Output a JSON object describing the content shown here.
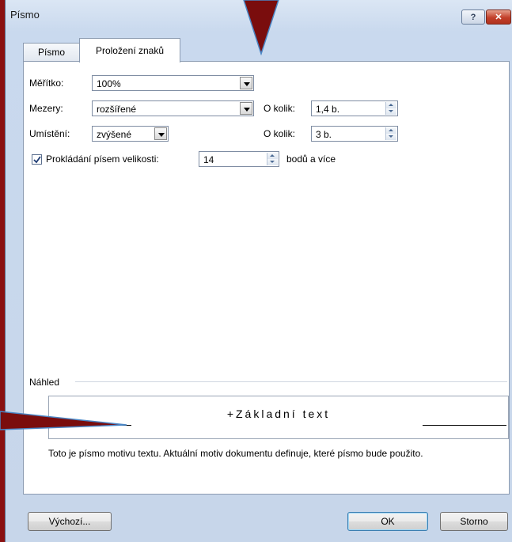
{
  "window": {
    "title": "Písmo"
  },
  "tabs": [
    {
      "label": "Písmo",
      "active": false
    },
    {
      "label": "Proložení znaků",
      "active": true
    }
  ],
  "fields": {
    "scale": {
      "label": "Měřítko:",
      "value": "100%"
    },
    "spacing": {
      "label": "Mezery:",
      "value": "rozšířené",
      "by_label": "O kolik:",
      "by_value": "1,4 b."
    },
    "position": {
      "label": "Umístění:",
      "value": "zvýšené",
      "by_label": "O kolik:",
      "by_value": "3 b."
    },
    "kerning": {
      "checked": true,
      "label": "Prokládání písem velikosti:",
      "value": "14",
      "suffix": "bodů a více"
    }
  },
  "preview": {
    "heading": "Náhled",
    "sample": "+Základní text",
    "description": "Toto je písmo motivu textu. Aktuální motiv dokumentu definuje, které písmo bude použito."
  },
  "buttons": {
    "default": "Výchozí...",
    "ok": "OK",
    "cancel": "Storno"
  },
  "colors": {
    "background": "#7a0d0d",
    "dialog": "#dbe6f4",
    "close": "#c2402a"
  }
}
